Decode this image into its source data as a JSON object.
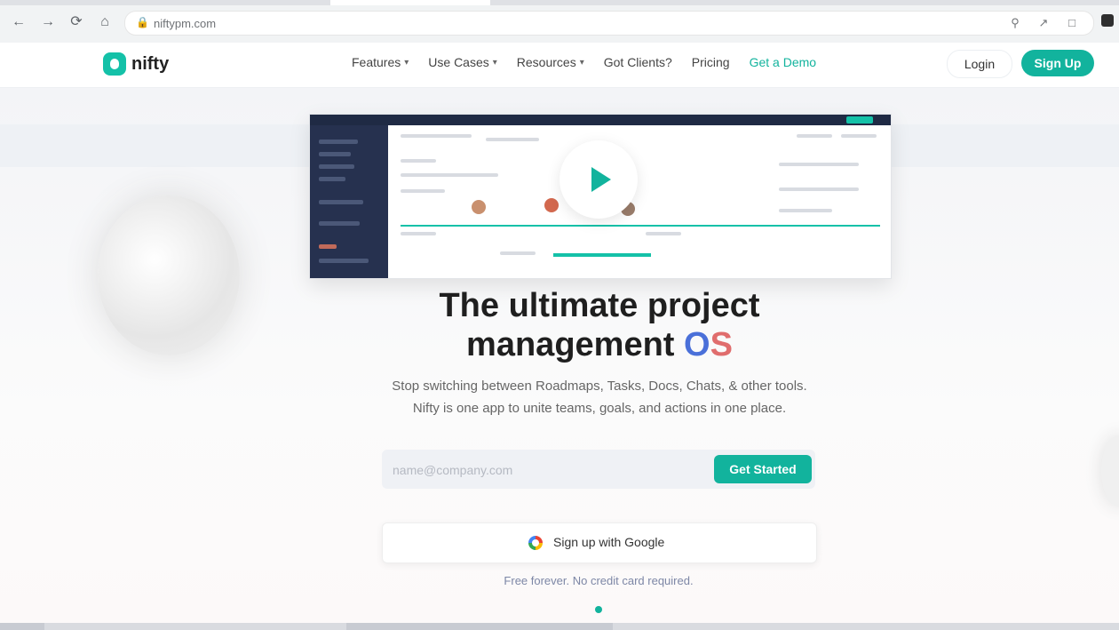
{
  "browser": {
    "url": "niftypm.com",
    "nav_icons": [
      "back-icon",
      "forward-icon",
      "reload-icon",
      "home-icon"
    ],
    "omnibox_icons": [
      "search-icon",
      "share-icon",
      "extension-icon"
    ]
  },
  "header": {
    "logo_text": "nifty",
    "nav": [
      {
        "label": "Features",
        "dropdown": true
      },
      {
        "label": "Use Cases",
        "dropdown": true
      },
      {
        "label": "Resources",
        "dropdown": true
      },
      {
        "label": "Got Clients?",
        "dropdown": false
      },
      {
        "label": "Pricing",
        "dropdown": false
      },
      {
        "label": "Get a Demo",
        "dropdown": false,
        "accent": true
      }
    ],
    "login_label": "Login",
    "signup_label": "Sign Up"
  },
  "hero": {
    "headline_line1": "The ultimate project",
    "headline_line2": "management",
    "headline_os_1": "O",
    "headline_os_2": "S",
    "subtitle_line1": "Stop switching between Roadmaps, Tasks, Docs, Chats, & other tools.",
    "subtitle_line2": "Nifty is one app to unite teams, goals, and actions in one place.",
    "email_placeholder": "name@company.com",
    "get_started_label": "Get Started",
    "google_label": "Sign up with Google",
    "free_note": "Free forever. No credit card required."
  },
  "colors": {
    "accent": "#12b39d",
    "text": "#1f1f1f"
  }
}
